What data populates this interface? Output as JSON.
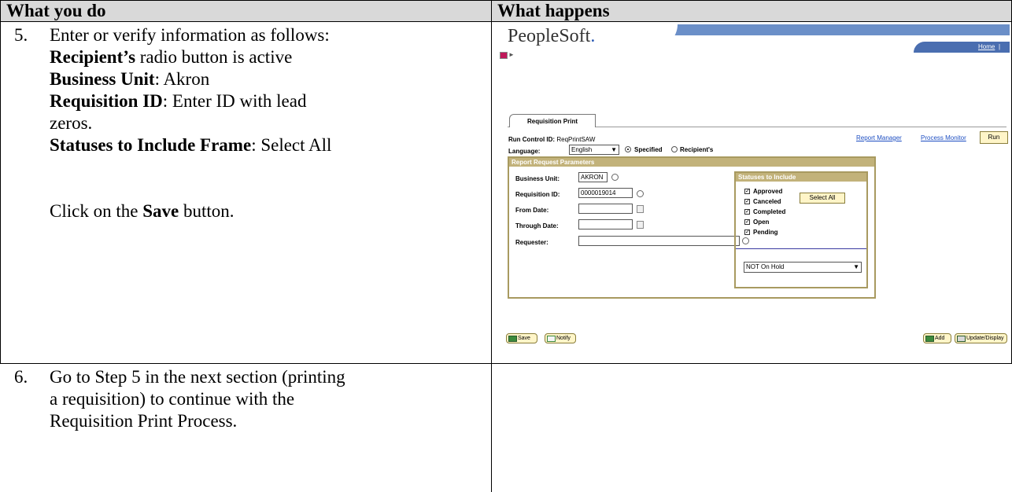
{
  "table": {
    "col1_header": "What you do",
    "col2_header": "What happens"
  },
  "step5": {
    "number": "5.",
    "intro": "Enter or verify information as follows:",
    "recipients_bold": "Recipient’s",
    "recipients_rest": " radio button is active",
    "bu_bold": "Business Unit",
    "bu_rest": ":  Akron",
    "req_bold": "Requisition ID",
    "req_rest": ":  Enter ID with lead",
    "req_rest2": "zeros.",
    "status_bold": "Statuses to Include Frame",
    "status_rest": ":  Select All",
    "click_pre": "Click on the ",
    "click_bold": "Save",
    "click_post": " button."
  },
  "step6": {
    "number": "6.",
    "line1": "Go to Step 5 in the next section (printing",
    "line2": "a requisition) to continue with the",
    "line3": "Requisition Print Process."
  },
  "screenshot": {
    "logo": "PeopleSoft",
    "logo_dot": ".",
    "nav_home": "Home",
    "nav_sep": "|",
    "tab": "Requisition Print",
    "run_control_label": "Run Control ID:",
    "run_control_value": "ReqPrintSAW",
    "report_manager": "Report Manager",
    "process_monitor": "Process Monitor",
    "run_button": "Run",
    "language_label": "Language:",
    "language_value": "English",
    "specified": "Specified",
    "recipients": "Recipient's",
    "params_header": "Report Request Parameters",
    "business_unit_label": "Business Unit:",
    "business_unit_value": "AKRON",
    "requisition_id_label": "Requisition ID:",
    "requisition_id_value": "0000019014",
    "from_date_label": "From Date:",
    "through_date_label": "Through Date:",
    "requester_label": "Requester:",
    "statuses_header": "Statuses to Include",
    "statuses": [
      "Approved",
      "Canceled",
      "Completed",
      "Open",
      "Pending"
    ],
    "select_all": "Select All",
    "hold_value": "NOT On Hold",
    "save": "Save",
    "notify": "Notify",
    "add": "Add",
    "update_display": "Update/Display"
  }
}
